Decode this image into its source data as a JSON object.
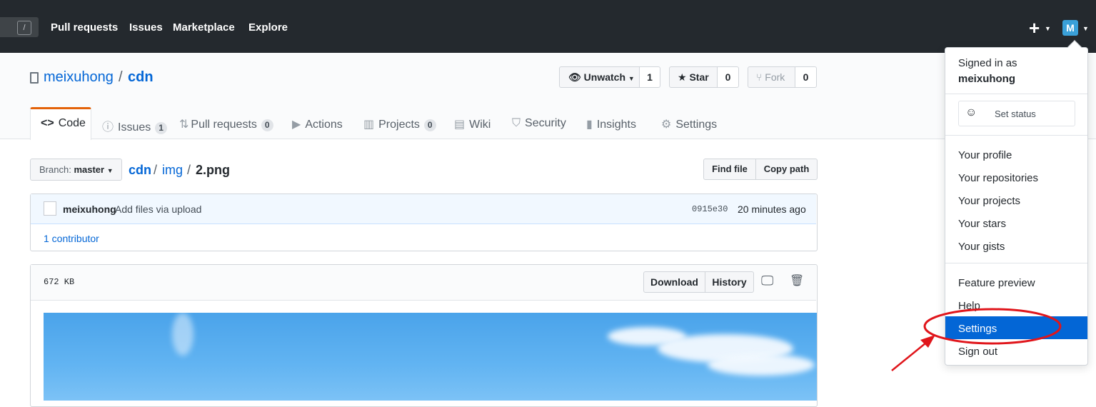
{
  "topbar": {
    "search_shortcut": "/",
    "nav": [
      "Pull requests",
      "Issues",
      "Marketplace",
      "Explore"
    ],
    "plus_icon": "plus-icon",
    "avatar_letter": "M"
  },
  "repo": {
    "owner": "meixuhong",
    "separator": "/",
    "name": "cdn",
    "unwatch_label": "Unwatch",
    "watch_count": "1",
    "star_label": "Star",
    "star_count": "0",
    "fork_label": "Fork",
    "fork_count": "0"
  },
  "tabs": [
    {
      "label": "Code",
      "icon": "code-icon"
    },
    {
      "label": "Issues",
      "count": "1",
      "icon": "issue-icon"
    },
    {
      "label": "Pull requests",
      "count": "0",
      "icon": "pull-request-icon"
    },
    {
      "label": "Actions",
      "icon": "play-icon"
    },
    {
      "label": "Projects",
      "count": "0",
      "icon": "project-icon"
    },
    {
      "label": "Wiki",
      "icon": "book-icon"
    },
    {
      "label": "Security",
      "icon": "shield-icon"
    },
    {
      "label": "Insights",
      "icon": "graph-icon"
    },
    {
      "label": "Settings",
      "icon": "gear-icon"
    }
  ],
  "branch": {
    "prefix": "Branch:",
    "name": "master"
  },
  "breadcrumb": {
    "root": "cdn",
    "folder": "img",
    "file": "2.png",
    "sep": "/"
  },
  "file_actions": {
    "find": "Find file",
    "copy": "Copy path"
  },
  "commit": {
    "author": "meixuhong",
    "message": "Add files via upload",
    "sha": "0915e30",
    "time": "20 minutes ago",
    "contributors": "1 contributor"
  },
  "file": {
    "size": "672 KB",
    "download": "Download",
    "history": "History"
  },
  "dropdown": {
    "signed_in_as": "Signed in as",
    "username": "meixuhong",
    "set_status": "Set status",
    "items_1": [
      "Your profile",
      "Your repositories",
      "Your projects",
      "Your stars",
      "Your gists"
    ],
    "items_2": [
      "Feature preview",
      "Help",
      "Settings",
      "Sign out"
    ]
  },
  "colors": {
    "accent": "#0366d6",
    "highlight_ring": "#e0151b",
    "tab_underline": "#e36209"
  }
}
